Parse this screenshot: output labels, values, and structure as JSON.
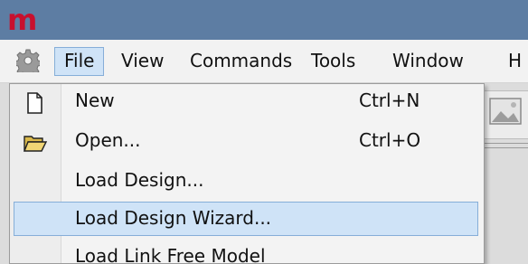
{
  "app": {
    "logo_text": "m"
  },
  "menubar": {
    "items": [
      {
        "label": "File",
        "active": true
      },
      {
        "label": "View"
      },
      {
        "label": "Commands"
      },
      {
        "label": "Tools"
      },
      {
        "label": "Window"
      },
      {
        "label": "H"
      }
    ]
  },
  "file_menu": {
    "items": [
      {
        "label": "New",
        "shortcut": "Ctrl+N",
        "icon": "new-document-icon"
      },
      {
        "label": "Open...",
        "shortcut": "Ctrl+O",
        "icon": "open-folder-icon"
      },
      {
        "label": "Load Design..."
      },
      {
        "label": "Load Design Wizard...",
        "highlighted": true
      },
      {
        "label": "Load Link Free Model"
      }
    ]
  },
  "colors": {
    "titlebar": "#5d7da3",
    "logo": "#c8102e",
    "highlight": "#cfe3f7",
    "highlight_border": "#86aed8"
  }
}
